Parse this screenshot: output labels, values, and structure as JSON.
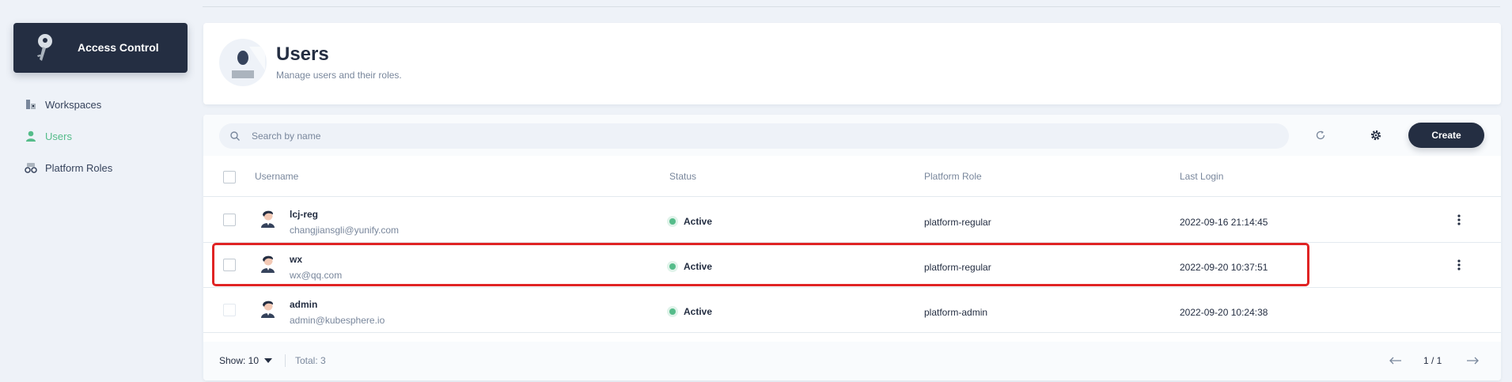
{
  "sidebar": {
    "brand_title": "Access Control",
    "items": [
      {
        "label": "Workspaces",
        "icon": "workspace-icon",
        "active": false
      },
      {
        "label": "Users",
        "icon": "user-icon",
        "active": true
      },
      {
        "label": "Platform Roles",
        "icon": "roles-icon",
        "active": false
      }
    ]
  },
  "header": {
    "title": "Users",
    "description": "Manage users and their roles."
  },
  "toolbar": {
    "search_placeholder": "Search by name",
    "create_label": "Create"
  },
  "table": {
    "columns": [
      "Username",
      "Status",
      "Platform Role",
      "Last Login"
    ],
    "rows": [
      {
        "username": "lcj-reg",
        "email": "changjiansgli@yunify.com",
        "status": "Active",
        "role": "platform-regular",
        "last_login": "2022-09-16 21:14:45",
        "has_menu": true
      },
      {
        "username": "wx",
        "email": "wx@qq.com",
        "status": "Active",
        "role": "platform-regular",
        "last_login": "2022-09-20 10:37:51",
        "has_menu": true
      },
      {
        "username": "admin",
        "email": "admin@kubesphere.io",
        "status": "Active",
        "role": "platform-admin",
        "last_login": "2022-09-20 10:24:38",
        "has_menu": false
      }
    ]
  },
  "footer": {
    "show_label": "Show: 10",
    "total_label": "Total: 3",
    "page_label": "1 / 1"
  },
  "colors": {
    "accent_green": "#55bc8a",
    "dark": "#242e42",
    "highlight_red": "#e02424"
  }
}
